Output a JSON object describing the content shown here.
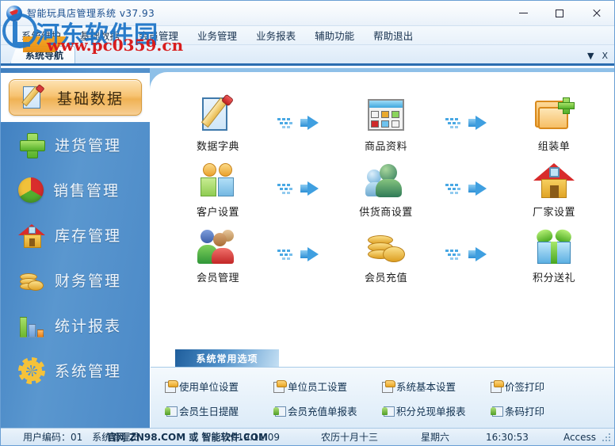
{
  "window": {
    "title": "智能玩具店管理系统 v37.93",
    "minimize": "—",
    "maximize": "□",
    "close": "✕"
  },
  "menubar": {
    "items": [
      {
        "label": "系统维护"
      },
      {
        "label": "基础数据"
      },
      {
        "label": "会员管理"
      },
      {
        "label": "业务管理"
      },
      {
        "label": "业务报表"
      },
      {
        "label": "辅助功能"
      },
      {
        "label": "帮助退出"
      }
    ]
  },
  "tabstrip": {
    "tabs": [
      {
        "label": "系统导航"
      }
    ],
    "dropdown": "▼",
    "close": "X"
  },
  "sidebar": {
    "items": [
      {
        "label": "基础数据",
        "icon": "pencil-paper-icon",
        "selected": true
      },
      {
        "label": "进货管理",
        "icon": "green-plus-icon",
        "selected": false
      },
      {
        "label": "销售管理",
        "icon": "pie-chart-icon",
        "selected": false
      },
      {
        "label": "库存管理",
        "icon": "house-icon",
        "selected": false
      },
      {
        "label": "财务管理",
        "icon": "coins-icon",
        "selected": false
      },
      {
        "label": "统计报表",
        "icon": "bar-chart-icon",
        "selected": false
      },
      {
        "label": "系统管理",
        "icon": "gear-icon",
        "selected": false
      }
    ]
  },
  "flow": {
    "arrow_icon": "blue-arrow-right-icon",
    "rows": [
      {
        "cells": [
          {
            "label": "数据字典",
            "icon": "dictionary-icon"
          },
          {
            "label": "商品资料",
            "icon": "goods-window-icon"
          },
          {
            "label": "组装单",
            "icon": "folder-plus-icon"
          }
        ]
      },
      {
        "cells": [
          {
            "label": "客户设置",
            "icon": "two-customers-icon"
          },
          {
            "label": "供货商设置",
            "icon": "supplier-people-icon"
          },
          {
            "label": "厂家设置",
            "icon": "factory-house-icon"
          }
        ]
      },
      {
        "cells": [
          {
            "label": "会员管理",
            "icon": "members-group-icon"
          },
          {
            "label": "会员充值",
            "icon": "gold-coins-icon"
          },
          {
            "label": "积分送礼",
            "icon": "gift-box-icon"
          }
        ]
      }
    ]
  },
  "options_panel": {
    "header": "系统常用选项",
    "rows": [
      [
        {
          "label": "使用单位设置",
          "icon": "clipboard-gold-icon"
        },
        {
          "label": "单位员工设置",
          "icon": "clipboard-gold-icon"
        },
        {
          "label": "系统基本设置",
          "icon": "clipboard-gold-icon"
        },
        {
          "label": "价签打印",
          "icon": "clipboard-gold-icon"
        }
      ],
      [
        {
          "label": "会员生日提醒",
          "icon": "person-card-icon"
        },
        {
          "label": "会员充值单报表",
          "icon": "person-card-icon"
        },
        {
          "label": "积分兑现单报表",
          "icon": "person-card-icon"
        },
        {
          "label": "条码打印",
          "icon": "person-card-icon"
        }
      ]
    ]
  },
  "statusbar": {
    "user_code": "用户编码：01",
    "user_role": "系统管理员",
    "site_overlay": "官网 ZN98.COM 或 智能软件.COM",
    "date": "2019.11.09",
    "lunar": "农历十月十三",
    "weekday": "星期六",
    "time": "16:30:53",
    "database": "Access"
  },
  "watermark": {
    "site_cn": "河东软件园",
    "site_url": "www.pc0359.cn"
  },
  "colors": {
    "accent_blue": "#3f7fc0",
    "selected_orange": "#f0b254",
    "panel_white": "#ffffff",
    "watermark_blue": "#1f76c8",
    "watermark_red": "#d81d1d"
  }
}
